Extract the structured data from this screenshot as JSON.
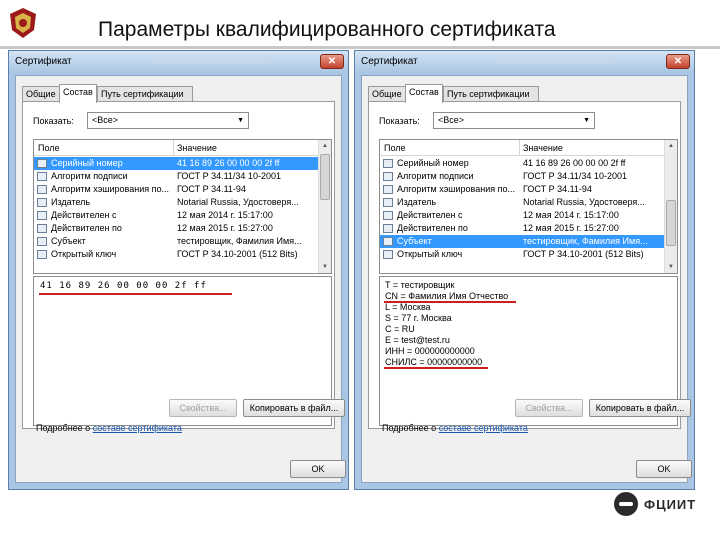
{
  "slide": {
    "title": "Параметры квалифицированного сертификата",
    "logo_text": "ФЦИИТ"
  },
  "dialogs": [
    {
      "title": "Сертификат",
      "close_label": "✕",
      "tabs": [
        {
          "label": "Общие",
          "active": false
        },
        {
          "label": "Состав",
          "active": true
        },
        {
          "label": "Путь сертификации",
          "active": false
        }
      ],
      "show_label": "Показать:",
      "show_value": "<Все>",
      "columns": {
        "field": "Поле",
        "value": "Значение"
      },
      "rows": [
        {
          "field": "Серийный номер",
          "value": "41 16 89 26 00 00 00 2f ff",
          "selected": true
        },
        {
          "field": "Алгоритм подписи",
          "value": "ГОСТ Р 34.11/34 10-2001",
          "selected": false
        },
        {
          "field": "Алгоритм хэширования по...",
          "value": "ГОСТ Р 34.11-94",
          "selected": false
        },
        {
          "field": "Издатель",
          "value": "Notarial Russia, Удостоверя...",
          "selected": false
        },
        {
          "field": "Действителен с",
          "value": "12 мая 2014 г. 15:17:00",
          "selected": false
        },
        {
          "field": "Действителен по",
          "value": "12 мая 2015 г. 15:27:00",
          "selected": false
        },
        {
          "field": "Субъект",
          "value": "тестировщик, Фамилия Имя...",
          "selected": false
        },
        {
          "field": "Открытый ключ",
          "value": "ГОСТ Р 34.10-2001 (512 Bits)",
          "selected": false
        }
      ],
      "detail_hex": "41 16 89 26 00 00 00 2f ff",
      "detail_lines": [],
      "properties_label": "Свойства...",
      "copy_label": "Копировать в файл...",
      "more_prefix": "Подробнее о",
      "more_link": "составе сертификата",
      "ok_label": "OK"
    },
    {
      "title": "Сертификат",
      "close_label": "✕",
      "tabs": [
        {
          "label": "Общие",
          "active": false
        },
        {
          "label": "Состав",
          "active": true
        },
        {
          "label": "Путь сертификации",
          "active": false
        }
      ],
      "show_label": "Показать:",
      "show_value": "<Все>",
      "columns": {
        "field": "Поле",
        "value": "Значение"
      },
      "rows": [
        {
          "field": "Серийный номер",
          "value": "41 16 89 26 00 00 00 2f ff",
          "selected": false
        },
        {
          "field": "Алгоритм подписи",
          "value": "ГОСТ Р 34.11/34 10-2001",
          "selected": false
        },
        {
          "field": "Алгоритм хэширования по...",
          "value": "ГОСТ Р 34.11-94",
          "selected": false
        },
        {
          "field": "Издатель",
          "value": "Notarial Russia, Удостоверя...",
          "selected": false
        },
        {
          "field": "Действителен с",
          "value": "12 мая 2014 г. 15:17:00",
          "selected": false
        },
        {
          "field": "Действителен по",
          "value": "12 мая 2015 г. 15:27:00",
          "selected": false
        },
        {
          "field": "Субъект",
          "value": "тестировщик, Фамилия Имя...",
          "selected": true
        },
        {
          "field": "Открытый ключ",
          "value": "ГОСТ Р 34.10-2001 (512 Bits)",
          "selected": false
        }
      ],
      "detail_hex": "",
      "detail_lines": [
        "T = тестировщик",
        "CN = Фамилия Имя Отчество",
        "L = Москва",
        "S = 77 г. Москва",
        "C = RU",
        "E = test@test.ru",
        "ИНН = 000000000000",
        "СНИЛС = 00000000000"
      ],
      "properties_label": "Свойства...",
      "copy_label": "Копировать в файл...",
      "more_prefix": "Подробнее о",
      "more_link": "составе сертификата",
      "ok_label": "OK"
    }
  ],
  "colors": {
    "selection": "#3399ff",
    "underline": "#cc1f1f",
    "frame": "#a9c6e4"
  }
}
